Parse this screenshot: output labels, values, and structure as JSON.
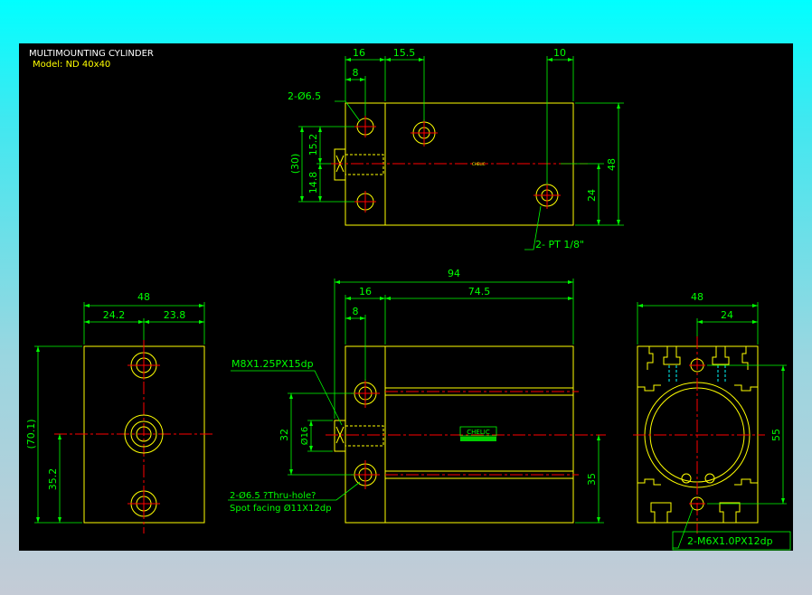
{
  "drawing": {
    "title": "MULTIMOUNTING CYLINDER",
    "model": "Model: ND 40x40"
  },
  "top_view": {
    "dim_16": "16",
    "dim_15_5": "15.5",
    "dim_10": "10",
    "dim_8": "8",
    "dim_48": "48",
    "dim_24": "24",
    "dim_15_2": "15.2",
    "dim_14_8": "14.8",
    "dim_30": "(30)",
    "hole_label": "2-Ø6.5",
    "port_label": "2- PT 1/8\""
  },
  "left_view": {
    "dim_48": "48",
    "dim_24_2": "24.2",
    "dim_23_8": "23.8",
    "dim_70_1": "(70.1)",
    "dim_35_2": "35.2"
  },
  "front_view": {
    "dim_94": "94",
    "dim_16": "16",
    "dim_74_5": "74.5",
    "dim_8": "8",
    "dim_32": "32",
    "dim_dia16": "Ø16",
    "dim_35": "35",
    "thread_label": "M8X1.25PX15dp",
    "hole_label": "2-Ø6.5 ?Thru-hole?",
    "spot_label": "Spot facing  Ø11X12dp",
    "logo_text": "CHELIC"
  },
  "right_view": {
    "dim_48": "48",
    "dim_24": "24",
    "dim_55": "55",
    "tap_label": "2-M6X1.0PX12dp"
  },
  "colors": {
    "background": "#000000",
    "dimension": "#00ff00",
    "outline": "#ffff00",
    "center": "#ff0000",
    "text": "#ffffff",
    "hidden": "#00ffff"
  }
}
